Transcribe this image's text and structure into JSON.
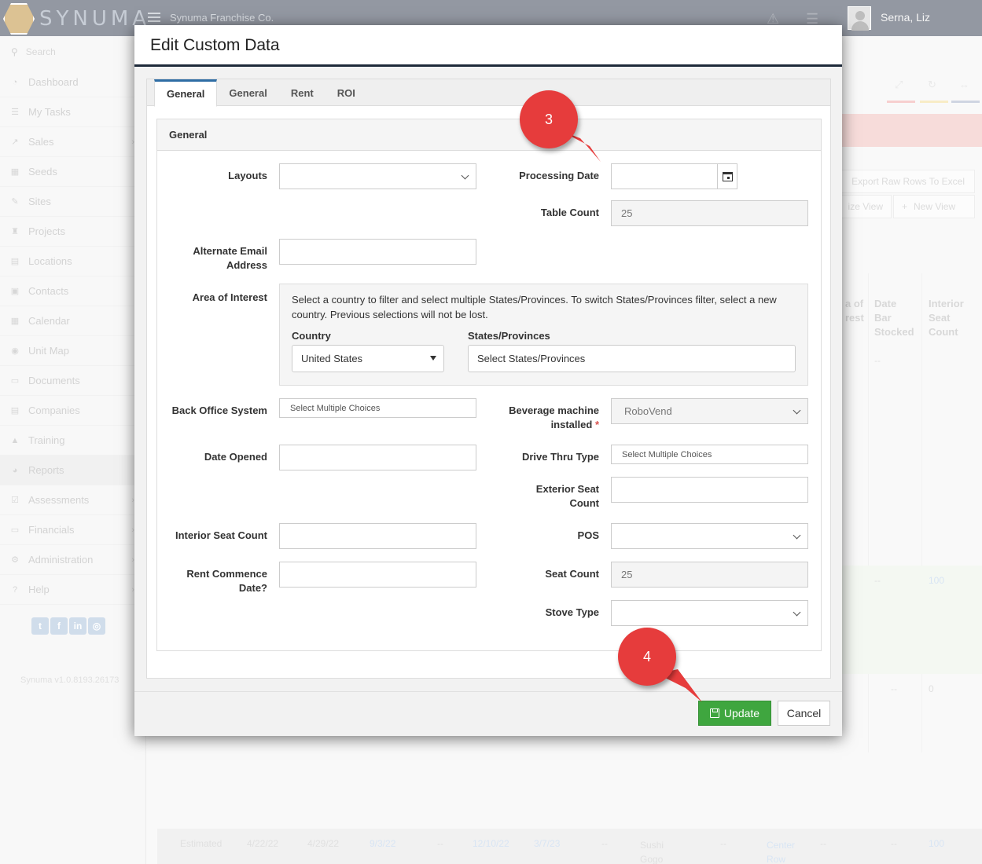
{
  "app": {
    "logo_text": "SYNUMA",
    "company": "Synuma Franchise Co.",
    "user": "Serna, Liz",
    "version": "Synuma v1.0.8193.26173"
  },
  "sidebar": {
    "search_placeholder": "Search",
    "items": [
      {
        "label": "Dashboard",
        "icon": "dashboard-icon"
      },
      {
        "label": "My Tasks",
        "icon": "tasks-icon"
      },
      {
        "label": "Sales",
        "icon": "sales-icon"
      },
      {
        "label": "Seeds",
        "icon": "seeds-icon"
      },
      {
        "label": "Sites",
        "icon": "sites-icon"
      },
      {
        "label": "Projects",
        "icon": "projects-icon"
      },
      {
        "label": "Locations",
        "icon": "locations-icon"
      },
      {
        "label": "Contacts",
        "icon": "contacts-icon"
      },
      {
        "label": "Calendar",
        "icon": "calendar-icon"
      },
      {
        "label": "Unit Map",
        "icon": "globe-icon"
      },
      {
        "label": "Documents",
        "icon": "documents-icon"
      },
      {
        "label": "Companies",
        "icon": "companies-icon"
      },
      {
        "label": "Training",
        "icon": "training-icon"
      },
      {
        "label": "Reports",
        "icon": "reports-icon"
      },
      {
        "label": "Assessments",
        "icon": "assessments-icon"
      },
      {
        "label": "Financials",
        "icon": "financials-icon"
      },
      {
        "label": "Administration",
        "icon": "admin-icon"
      },
      {
        "label": "Help",
        "icon": "help-icon"
      }
    ]
  },
  "background": {
    "export_label": "Export Raw Rows To Excel",
    "customize_view_label": "ize View",
    "new_view_label": "New View",
    "col_headers": {
      "interest": "a of\nrest",
      "date_bar_stocked": "Date\nBar\nStocked",
      "interior_seat_count": "Interior\nSeat\nCount"
    },
    "cells": {
      "dash1": "--",
      "dash2": "--",
      "val_100": "100",
      "dash3": "--",
      "val_0": "0"
    },
    "bottom_row": {
      "status": "Estimated",
      "d1": "4/22/22",
      "d2": "4/29/22",
      "d3": "9/3/22",
      "dash_a": "--",
      "d4": "12/10/22",
      "d5": "3/7/23",
      "dash_b": "--",
      "name": "Sushi\nGogo",
      "dash_c": "--",
      "center": "Center\nRow",
      "dash_d": "--",
      "dash_e": "--",
      "count": "100"
    }
  },
  "modal": {
    "title": "Edit Custom Data",
    "tabs": [
      "General",
      "General",
      "Rent",
      "ROI"
    ],
    "active_tab": 0,
    "panel_title": "General",
    "fields": {
      "layouts": {
        "label": "Layouts",
        "value": ""
      },
      "processing_date": {
        "label": "Processing Date",
        "value": ""
      },
      "table_count": {
        "label": "Table Count",
        "value": "25"
      },
      "alternate_email": {
        "label": "Alternate Email Address",
        "value": ""
      },
      "area_of_interest": {
        "label": "Area of Interest",
        "description": "Select a country to filter and select multiple States/Provinces. To switch States/Provinces filter, select a new country. Previous selections will not be lost.",
        "country_label": "Country",
        "country_value": "United States",
        "states_label": "States/Provinces",
        "states_placeholder": "Select States/Provinces"
      },
      "back_office_system": {
        "label": "Back Office System",
        "placeholder": "Select Multiple Choices"
      },
      "beverage_machine": {
        "label": "Beverage machine installed",
        "required_mark": "*",
        "value": "RoboVend"
      },
      "date_opened": {
        "label": "Date Opened",
        "value": ""
      },
      "drive_thru_type": {
        "label": "Drive Thru Type",
        "placeholder": "Select Multiple Choices"
      },
      "exterior_seat_count": {
        "label": "Exterior Seat Count",
        "value": ""
      },
      "interior_seat_count": {
        "label": "Interior Seat Count",
        "value": ""
      },
      "pos": {
        "label": "POS",
        "value": ""
      },
      "rent_commence_date": {
        "label": "Rent Commence Date?",
        "value": ""
      },
      "seat_count": {
        "label": "Seat Count",
        "value": "25"
      },
      "stove_type": {
        "label": "Stove Type",
        "value": ""
      }
    },
    "footer": {
      "update_label": "Update",
      "cancel_label": "Cancel"
    }
  },
  "callouts": [
    {
      "number": "3"
    },
    {
      "number": "4"
    }
  ],
  "colors": {
    "callout": "#e63c3c",
    "update_button": "#3fa63f",
    "header_rule": "#1e2a3a"
  }
}
